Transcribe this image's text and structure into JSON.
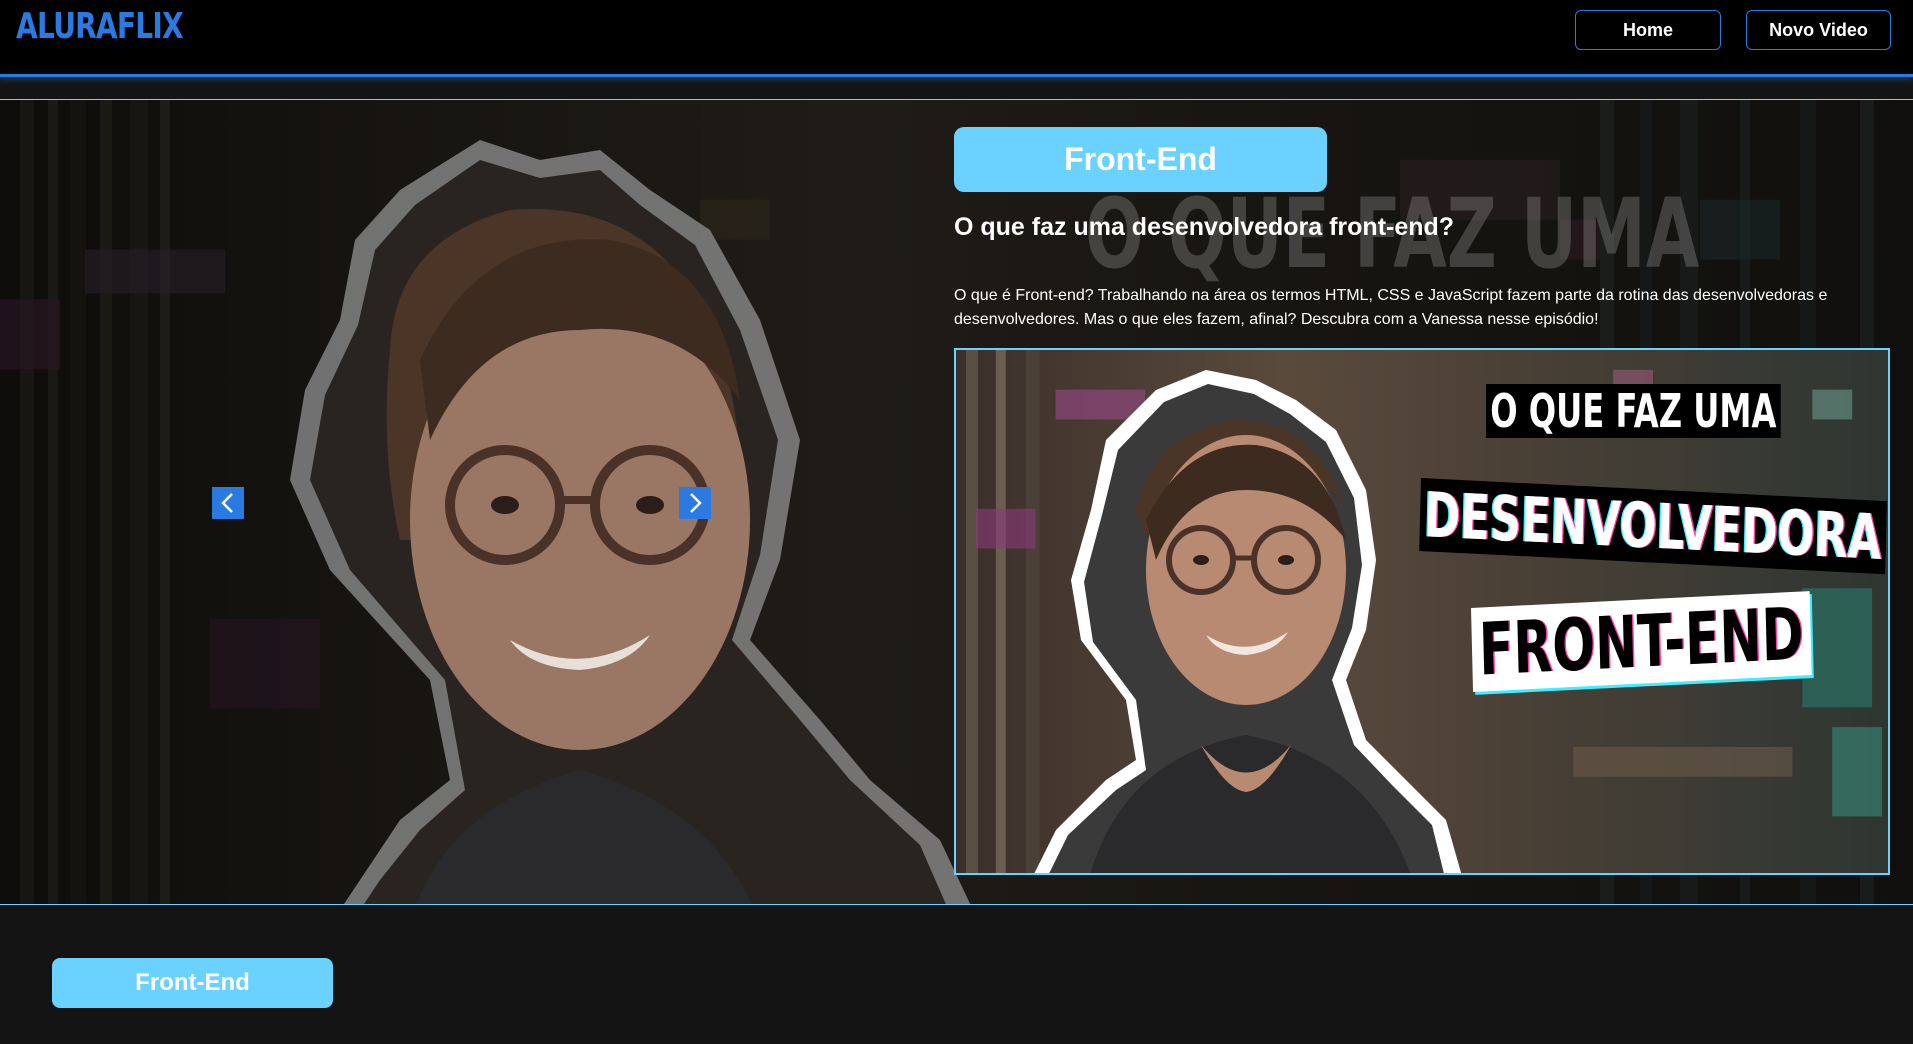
{
  "header": {
    "logo": "ALURAFLIX",
    "nav": {
      "home_label": "Home",
      "new_video_label": "Novo Video"
    }
  },
  "banner": {
    "category": "Front-End",
    "background_title": "O QUE FAZ UMA",
    "video_title": "O que faz uma desenvolvedora front-end?",
    "video_description": "O que é Front-end? Trabalhando na área os termos HTML, CSS e JavaScript fazem parte da rotina das desenvolvedoras e desenvolvedores. Mas o que eles fazem, afinal? Descubra com a Vanessa nesse episódio!",
    "thumbnail": {
      "line1": "O QUE FAZ UMA",
      "line2": "DESENVOLVEDORA",
      "line3": "FRONT-END"
    },
    "prev_icon": "chevron-left-icon",
    "next_icon": "chevron-right-icon"
  },
  "section": {
    "category_label": "Front-End"
  },
  "colors": {
    "accent": "#2a7ae2",
    "category": "#6bd1ff",
    "background": "#141414",
    "header_bg": "#000000"
  }
}
